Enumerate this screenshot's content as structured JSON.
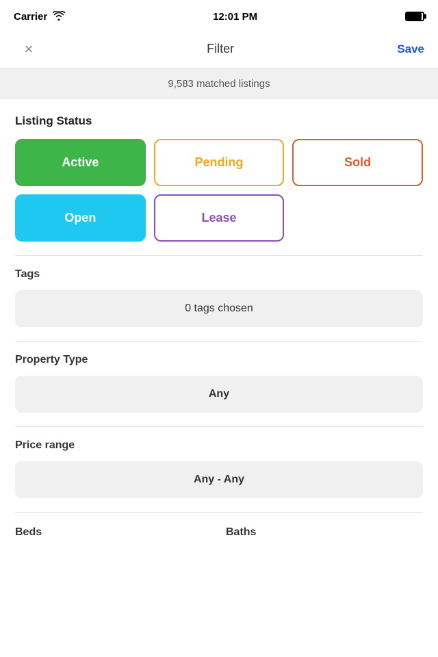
{
  "statusBar": {
    "carrier": "Carrier",
    "time": "12:01 PM"
  },
  "nav": {
    "closeLabel": "×",
    "title": "Filter",
    "saveLabel": "Save"
  },
  "matchedBanner": {
    "text": "9,583 matched listings"
  },
  "listingStatus": {
    "sectionTitle": "Listing Status",
    "buttons": [
      {
        "label": "Active",
        "style": "active",
        "selected": true
      },
      {
        "label": "Pending",
        "style": "pending",
        "selected": false
      },
      {
        "label": "Sold",
        "style": "sold",
        "selected": false
      },
      {
        "label": "Open",
        "style": "open",
        "selected": true
      },
      {
        "label": "Lease",
        "style": "lease",
        "selected": false
      }
    ]
  },
  "tags": {
    "label": "Tags",
    "value": "0 tags chosen"
  },
  "propertyType": {
    "label": "Property Type",
    "value": "Any"
  },
  "priceRange": {
    "label": "Price range",
    "value": "Any - Any"
  },
  "bedsLabel": "Beds",
  "bathsLabel": "Baths"
}
